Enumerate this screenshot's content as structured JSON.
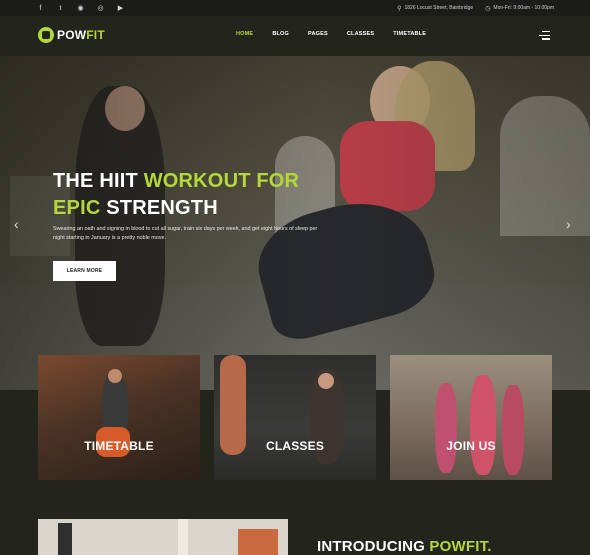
{
  "topbar": {
    "social": [
      {
        "icon": "facebook-icon",
        "glyph": "f"
      },
      {
        "icon": "twitter-icon",
        "glyph": "t"
      },
      {
        "icon": "github-icon",
        "glyph": "◉"
      },
      {
        "icon": "dribbble-icon",
        "glyph": "◎"
      },
      {
        "icon": "youtube-icon",
        "glyph": "▶"
      }
    ],
    "address": "1826 Locust Street, Bainbridge",
    "hours": "Mon-Fri: 9:00am - 10:00pm"
  },
  "header": {
    "logo_pow": "POW",
    "logo_fit": "FIT",
    "nav": [
      "HOME",
      "BLOG",
      "PAGES",
      "CLASSES",
      "TIMETABLE"
    ],
    "active_nav": "HOME"
  },
  "hero": {
    "title_part1": "THE HIIT ",
    "title_highlight1": "WORKOUT FOR",
    "title_highlight2": "EPIC",
    "title_part2": " STRENGTH",
    "subtitle": "Swearing an oath and signing in blood to cut all sugar, train six days per week, and get eight hours of sleep per night starting in January is a pretty noble move.",
    "button": "LEARN MORE"
  },
  "cards": [
    {
      "label": "TIMETABLE"
    },
    {
      "label": "CLASSES"
    },
    {
      "label": "JOIN US"
    }
  ],
  "intro": {
    "text": "INTRODUCING ",
    "highlight": "POWFIT."
  },
  "colors": {
    "accent": "#b6d73a",
    "background": "#23251d",
    "topbar": "#1b1c17"
  }
}
